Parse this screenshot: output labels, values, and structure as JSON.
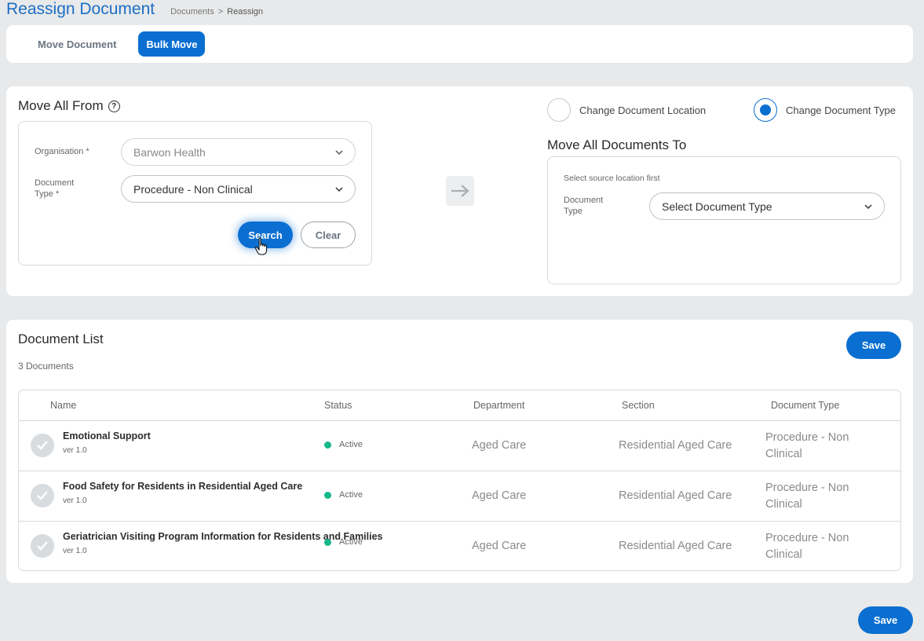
{
  "header": {
    "title": "Reassign Document",
    "breadcrumb": [
      "Documents",
      "Reassign"
    ],
    "separator": ">"
  },
  "tabs": [
    {
      "label": "Move Document",
      "active": false
    },
    {
      "label": "Bulk Move",
      "active": true
    }
  ],
  "move_from": {
    "heading": "Move All From",
    "help_icon": "?",
    "organisation": {
      "label": "Organisation *",
      "value": "Barwon Health",
      "disabled": true
    },
    "document_type": {
      "label_line1": "Document",
      "label_line2": "Type *",
      "value": "Procedure - Non Clinical"
    },
    "search_label": "Search",
    "clear_label": "Clear"
  },
  "move_to": {
    "options": [
      {
        "label": "Change Document Location",
        "checked": false
      },
      {
        "label": "Change Document Type",
        "checked": true
      }
    ],
    "heading": "Move All Documents To",
    "hint": "Select source location first",
    "document_type": {
      "label_line1": "Document",
      "label_line2": "Type",
      "placeholder": "Select Document Type"
    }
  },
  "document_list": {
    "heading": "Document List",
    "count_label": "3 Documents",
    "save_label": "Save",
    "columns": [
      "Name",
      "Status",
      "Department",
      "Section",
      "Document Type"
    ],
    "rows": [
      {
        "name": "Emotional Support",
        "version": "ver 1.0",
        "status": "Active",
        "department": "Aged Care",
        "section": "Residential Aged Care",
        "type_line1": "Procedure - Non",
        "type_line2": "Clinical"
      },
      {
        "name": "Food Safety for Residents in Residential Aged Care",
        "version": "ver 1.0",
        "status": "Active",
        "department": "Aged Care",
        "section": "Residential Aged Care",
        "type_line1": "Procedure - Non",
        "type_line2": "Clinical"
      },
      {
        "name": "Geriatrician Visiting Program Information for Residents and Families",
        "version": "ver 1.0",
        "status": "Active",
        "department": "Aged Care",
        "section": "Residential Aged Care",
        "type_line1": "Procedure - Non",
        "type_line2": "Clinical"
      }
    ]
  },
  "footer": {
    "save_label": "Save"
  },
  "colors": {
    "accent": "#0a6fd1",
    "status_active": "#14b88a",
    "page_bg": "#e8e9ea"
  }
}
